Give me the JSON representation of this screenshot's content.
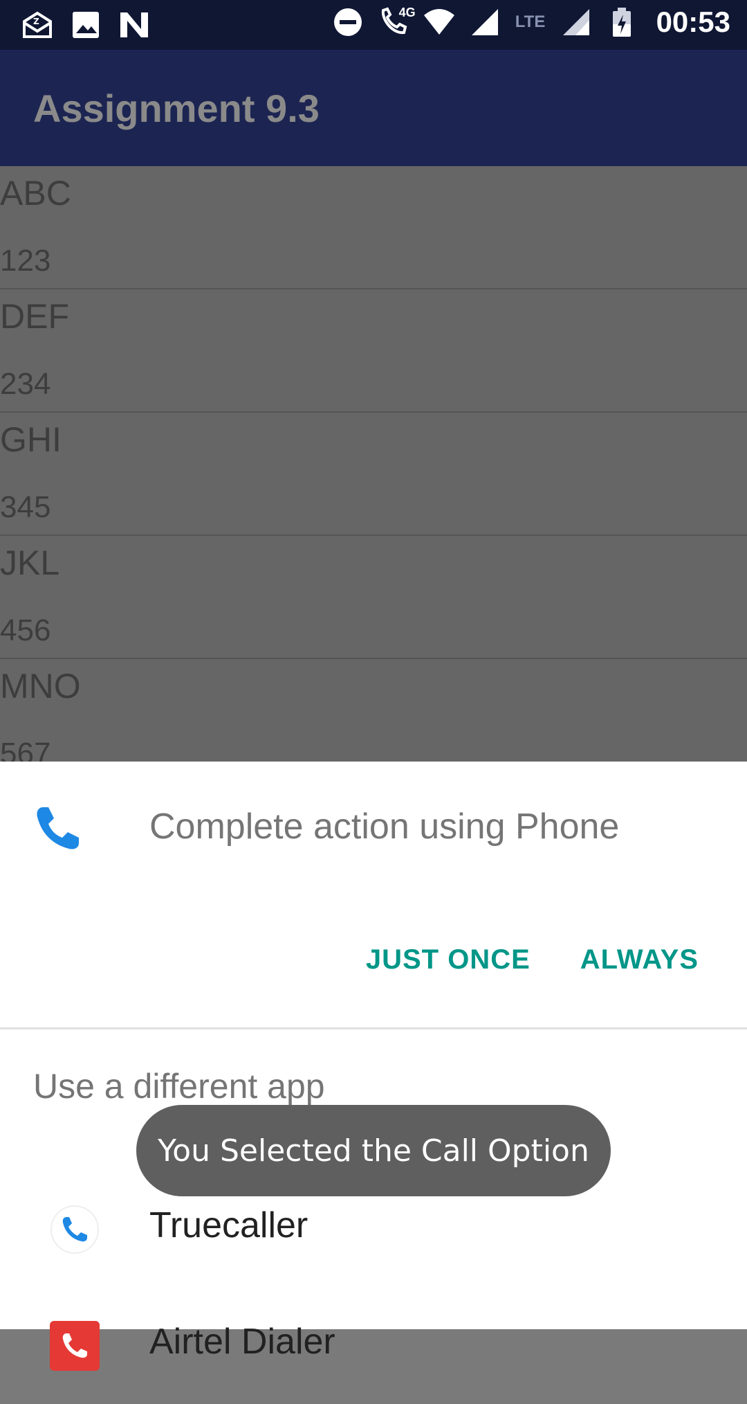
{
  "status_bar": {
    "time": "00:53",
    "network_label": "4G",
    "lte_label": "LTE",
    "left_icons": [
      "mail-icon",
      "image-icon",
      "n-logo-icon"
    ],
    "right_icons": [
      "do-not-disturb-icon",
      "wifi-call-icon",
      "wifi-icon",
      "signal-icon",
      "signal-icon",
      "battery-charging-icon"
    ]
  },
  "app_bar": {
    "title": "Assignment 9.3"
  },
  "contacts": [
    {
      "name": "ABC",
      "number": "123"
    },
    {
      "name": "DEF",
      "number": "234"
    },
    {
      "name": "GHI",
      "number": "345"
    },
    {
      "name": "JKL",
      "number": "456"
    },
    {
      "name": "MNO",
      "number": "567"
    }
  ],
  "chooser": {
    "title": "Complete action using Phone",
    "just_once": "JUST ONCE",
    "always": "ALWAYS",
    "different_app_label": "Use a different app",
    "apps": [
      {
        "label": "Truecaller",
        "icon": "truecaller-phone-icon"
      },
      {
        "label": "Airtel Dialer",
        "icon": "airtel-dialer-icon"
      }
    ]
  },
  "toast": {
    "message": "You Selected the Call Option"
  },
  "colors": {
    "status_bar": "#0f1733",
    "app_bar": "#1c2552",
    "accent": "#009688",
    "phone_blue": "#1e88e5",
    "airtel_red": "#e53935"
  }
}
